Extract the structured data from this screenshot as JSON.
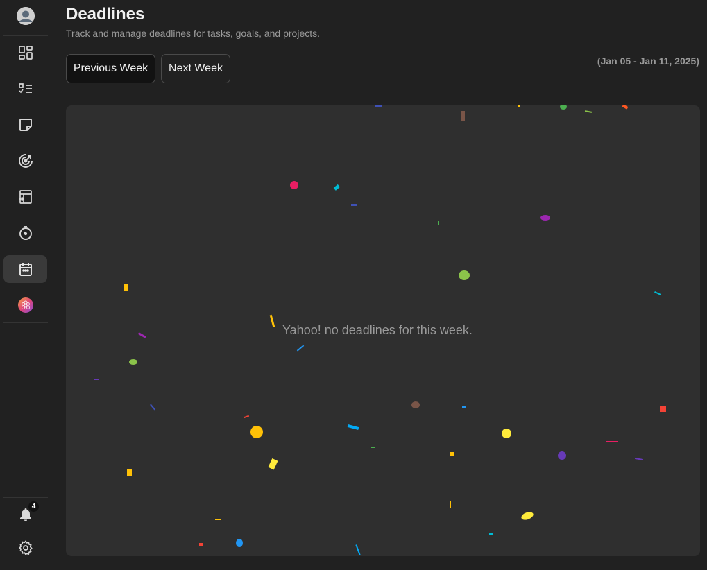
{
  "header": {
    "title": "Deadlines",
    "subtitle": "Track and manage deadlines for tasks, goals, and projects."
  },
  "controls": {
    "previous_label": "Previous Week",
    "next_label": "Next Week",
    "date_range": "(Jan 05 - Jan 11, 2025)"
  },
  "main": {
    "empty_message": "Yahoo! no deadlines for this week."
  },
  "sidebar": {
    "items": [
      {
        "name": "dashboard",
        "icon": "dashboard-icon"
      },
      {
        "name": "tasks",
        "icon": "checklist-icon"
      },
      {
        "name": "notes",
        "icon": "sticky-note-icon"
      },
      {
        "name": "goals",
        "icon": "target-icon"
      },
      {
        "name": "projects",
        "icon": "project-board-icon"
      },
      {
        "name": "timer",
        "icon": "stopwatch-icon"
      },
      {
        "name": "deadlines",
        "icon": "calendar-icon",
        "active": true
      },
      {
        "name": "integrations",
        "icon": "hexagon-cluster-icon"
      }
    ],
    "notifications_count": "4"
  },
  "colors": {
    "background": "#212121",
    "panel": "#2f2f2f",
    "text_primary": "#f1f1f1",
    "text_muted": "#9a9a9a"
  }
}
